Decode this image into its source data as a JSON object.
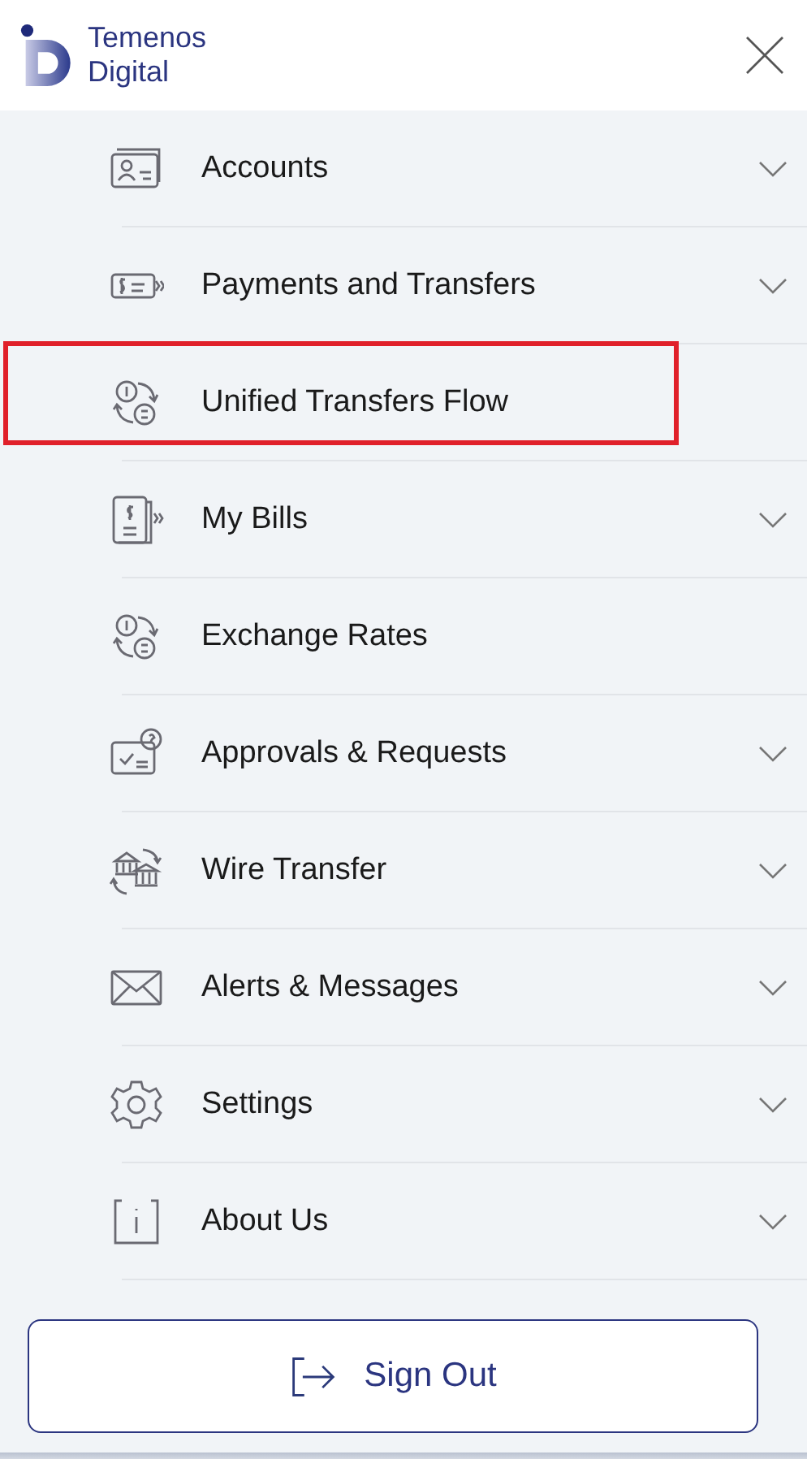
{
  "logo": {
    "line_1": "Temenos",
    "line_2": "Digital"
  },
  "menu": [
    {
      "label": "Accounts",
      "expandable": true,
      "highlighted": false
    },
    {
      "label": "Payments and Transfers",
      "expandable": true,
      "highlighted": false
    },
    {
      "label": "Unified Transfers Flow",
      "expandable": false,
      "highlighted": true
    },
    {
      "label": "My Bills",
      "expandable": true,
      "highlighted": false
    },
    {
      "label": "Exchange Rates",
      "expandable": false,
      "highlighted": false
    },
    {
      "label": "Approvals & Requests",
      "expandable": true,
      "highlighted": false
    },
    {
      "label": "Wire Transfer",
      "expandable": true,
      "highlighted": false
    },
    {
      "label": "Alerts & Messages",
      "expandable": true,
      "highlighted": false
    },
    {
      "label": "Settings",
      "expandable": true,
      "highlighted": false
    },
    {
      "label": "About Us",
      "expandable": true,
      "highlighted": false
    }
  ],
  "sign_out": {
    "label": "Sign Out"
  }
}
